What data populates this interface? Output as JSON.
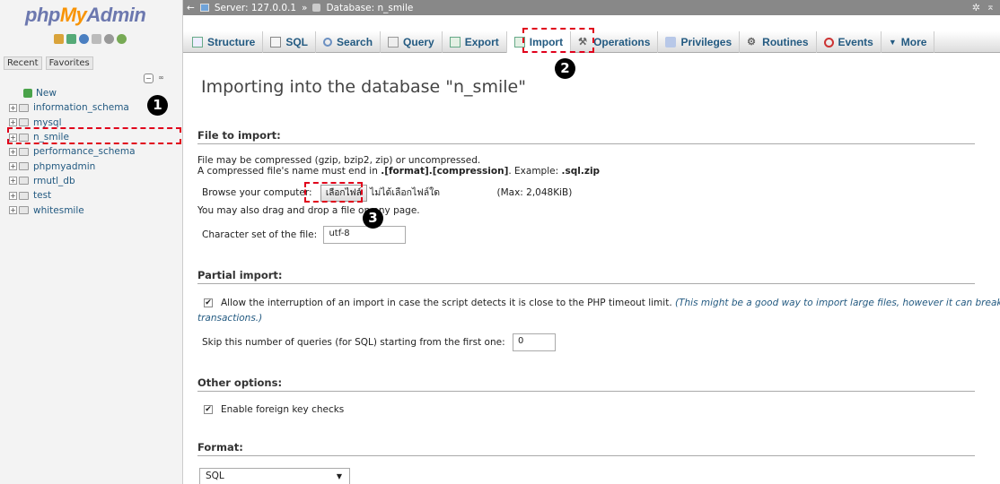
{
  "nav": {
    "logo_php": "php",
    "logo_my": "My",
    "logo_admin": "Admin",
    "recent_label": "Recent",
    "favorites_label": "Favorites",
    "databases": [
      {
        "name": "New"
      },
      {
        "name": "information_schema"
      },
      {
        "name": "mysql"
      },
      {
        "name": "n_smile"
      },
      {
        "name": "performance_schema"
      },
      {
        "name": "phpmyadmin"
      },
      {
        "name": "rmutl_db"
      },
      {
        "name": "test"
      },
      {
        "name": "whitesmile"
      }
    ]
  },
  "breadcrumb": {
    "server_label": "Server: 127.0.0.1",
    "separator": "»",
    "db_label": "Database: n_smile"
  },
  "tabs": [
    {
      "label": "Structure",
      "icon": "structure-icon"
    },
    {
      "label": "SQL",
      "icon": "sql-icon"
    },
    {
      "label": "Search",
      "icon": "search-icon"
    },
    {
      "label": "Query",
      "icon": "query-icon"
    },
    {
      "label": "Export",
      "icon": "export-icon"
    },
    {
      "label": "Import",
      "icon": "import-icon",
      "active": true
    },
    {
      "label": "Operations",
      "icon": "wrench-icon"
    },
    {
      "label": "Privileges",
      "icon": "privileges-icon"
    },
    {
      "label": "Routines",
      "icon": "routines-icon"
    },
    {
      "label": "Events",
      "icon": "clock-icon"
    },
    {
      "label": "More",
      "icon": "chevron-down-icon"
    }
  ],
  "page_title": "Importing into the database \"n_smile\"",
  "file_import": {
    "heading": "File to import:",
    "line1": "File may be compressed (gzip, bzip2, zip) or uncompressed.",
    "line2_prefix": "A compressed file's name must end in ",
    "line2_bold": ".[format].[compression]",
    "line2_mid": ". Example: ",
    "line2_example": ".sql.zip",
    "browse_label": "Browse your computer:",
    "choose_button": "เลือกไฟล์",
    "no_file_text": "ไม่ได้เลือกไฟล์ใด",
    "max_size": "(Max: 2,048KiB)",
    "drag_text": "You may also drag and drop a file on any page.",
    "charset_label": "Character set of the file:",
    "charset_value": "utf-8"
  },
  "partial_import": {
    "heading": "Partial import:",
    "allow_interrupt_label": "Allow the interruption of an import in case the script detects it is close to the PHP timeout limit.",
    "allow_interrupt_note_1": "(This might be a good way to import large files, however it can break",
    "allow_interrupt_note_2": "transactions.)",
    "allow_interrupt_checked": true,
    "skip_label": "Skip this number of queries (for SQL) starting from the first one:",
    "skip_value": "0"
  },
  "other_options": {
    "heading": "Other options:",
    "fk_label": "Enable foreign key checks",
    "fk_checked": true
  },
  "format": {
    "heading": "Format:",
    "selected": "SQL"
  },
  "annotations": {
    "marker1": "1",
    "marker2": "2",
    "marker3": "3",
    "color": "#e0001b"
  }
}
